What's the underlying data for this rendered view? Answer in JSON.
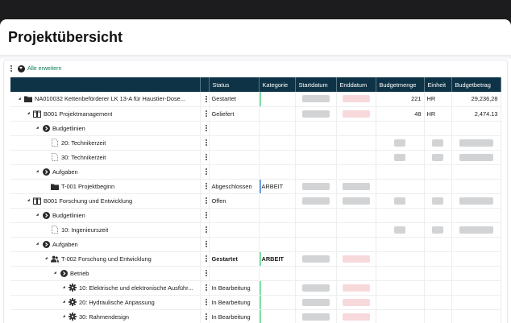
{
  "page_title": "Projektübersicht",
  "toolbar": {
    "expand_all": "Alle erweitern"
  },
  "columns": [
    "",
    "Status",
    "Kategorie",
    "Startdatum",
    "Enddatum",
    "Budgetmenge",
    "Einheit",
    "Budgetbetrag"
  ],
  "rows": [
    {
      "name": "NA010032 Kettenbeförderer LK 13-A für Haustier-Dose...",
      "icon": "folder-icon",
      "level": 0,
      "toggle": true,
      "status": "Gestartet",
      "status_bold": false,
      "kategorie": "",
      "accent": "green",
      "start_date": "placeholder",
      "end_date": "placeholder-red",
      "budgetmenge": "221",
      "einheit": "HR",
      "budgetbetrag": "29,236,28"
    },
    {
      "name": "B001 Projektmanagement",
      "icon": "book-icon",
      "level": 1,
      "toggle": true,
      "status": "Geliefert",
      "status_bold": false,
      "kategorie": "",
      "accent": "",
      "start_date": "placeholder",
      "end_date": "placeholder-red",
      "budgetmenge": "48",
      "einheit": "HR",
      "budgetbetrag": "2,474.13"
    },
    {
      "name": "Budgetlinien",
      "icon": "chevron-circle-icon",
      "level": 2,
      "toggle": true,
      "status": "",
      "status_bold": false,
      "kategorie": "",
      "accent": "",
      "start_date": "",
      "end_date": "",
      "budgetmenge": "",
      "einheit": "",
      "budgetbetrag": ""
    },
    {
      "name": "20: Technikerzeit",
      "icon": "document-icon",
      "level": 3,
      "toggle": false,
      "status": "",
      "status_bold": false,
      "kategorie": "",
      "accent": "",
      "start_date": "",
      "end_date": "",
      "budgetmenge": "placeholder",
      "einheit": "placeholder",
      "budgetbetrag": "placeholder"
    },
    {
      "name": "30: Technikerzeit",
      "icon": "document-icon",
      "level": 3,
      "toggle": false,
      "status": "",
      "status_bold": false,
      "kategorie": "",
      "accent": "",
      "start_date": "",
      "end_date": "",
      "budgetmenge": "placeholder",
      "einheit": "placeholder",
      "budgetbetrag": "placeholder"
    },
    {
      "name": "Aufgaben",
      "icon": "chevron-circle-icon",
      "level": 2,
      "toggle": true,
      "status": "",
      "status_bold": false,
      "kategorie": "",
      "accent": "",
      "start_date": "",
      "end_date": "",
      "budgetmenge": "",
      "einheit": "",
      "budgetbetrag": ""
    },
    {
      "name": "T-001 Projektbeginn",
      "icon": "folder-icon",
      "level": 3,
      "toggle": false,
      "status": "Abgeschlossen",
      "status_bold": false,
      "kategorie": "ARBEIT",
      "accent": "blue",
      "start_date": "placeholder",
      "end_date": "placeholder",
      "budgetmenge": "",
      "einheit": "",
      "budgetbetrag": ""
    },
    {
      "name": "B001 Forschung und Entwicklung",
      "icon": "book-icon",
      "level": 1,
      "toggle": true,
      "status": "Offen",
      "status_bold": false,
      "kategorie": "",
      "accent": "",
      "start_date": "placeholder",
      "end_date": "placeholder",
      "budgetmenge": "placeholder",
      "einheit": "placeholder",
      "budgetbetrag": "placeholder"
    },
    {
      "name": "Budgetlinien",
      "icon": "chevron-circle-icon",
      "level": 2,
      "toggle": true,
      "status": "",
      "status_bold": false,
      "kategorie": "",
      "accent": "",
      "start_date": "",
      "end_date": "",
      "budgetmenge": "",
      "einheit": "",
      "budgetbetrag": ""
    },
    {
      "name": "10: Ingenieurszeit",
      "icon": "document-icon",
      "level": 3,
      "toggle": false,
      "status": "",
      "status_bold": false,
      "kategorie": "",
      "accent": "",
      "start_date": "",
      "end_date": "",
      "budgetmenge": "placeholder",
      "einheit": "placeholder",
      "budgetbetrag": "placeholder"
    },
    {
      "name": "Aufgaben",
      "icon": "chevron-circle-icon",
      "level": 2,
      "toggle": true,
      "status": "",
      "status_bold": false,
      "kategorie": "",
      "accent": "",
      "start_date": "",
      "end_date": "",
      "budgetmenge": "",
      "einheit": "",
      "budgetbetrag": ""
    },
    {
      "name": "T-002 Forschung und Entwicklung",
      "icon": "people-icon",
      "level": 3,
      "toggle": true,
      "status": "Gestartet",
      "status_bold": true,
      "kategorie": "ARBEIT",
      "accent": "green",
      "start_date": "placeholder",
      "end_date": "placeholder-red",
      "budgetmenge": "",
      "einheit": "",
      "budgetbetrag": ""
    },
    {
      "name": "Betrieb",
      "icon": "chevron-circle-icon",
      "level": 4,
      "toggle": true,
      "status": "",
      "status_bold": false,
      "kategorie": "",
      "accent": "",
      "start_date": "",
      "end_date": "",
      "budgetmenge": "",
      "einheit": "",
      "budgetbetrag": ""
    },
    {
      "name": "10: Elektrische und elektronische Ausführ...",
      "icon": "gear-icon",
      "level": 5,
      "toggle": true,
      "status": "In Bearbeitung",
      "status_bold": false,
      "kategorie": "",
      "accent": "green",
      "start_date": "placeholder",
      "end_date": "placeholder-red",
      "budgetmenge": "",
      "einheit": "",
      "budgetbetrag": ""
    },
    {
      "name": "20: Hydraulische Anpassung",
      "icon": "gear-icon",
      "level": 5,
      "toggle": true,
      "status": "In Bearbeitung",
      "status_bold": false,
      "kategorie": "",
      "accent": "green",
      "start_date": "placeholder",
      "end_date": "placeholder-red",
      "budgetmenge": "",
      "einheit": "",
      "budgetbetrag": ""
    },
    {
      "name": "30: Rahmendesign",
      "icon": "gear-icon",
      "level": 5,
      "toggle": true,
      "status": "In Bearbeitung",
      "status_bold": false,
      "kategorie": "",
      "accent": "green",
      "start_date": "placeholder",
      "end_date": "placeholder-red",
      "budgetmenge": "",
      "einheit": "",
      "budgetbetrag": ""
    }
  ]
}
